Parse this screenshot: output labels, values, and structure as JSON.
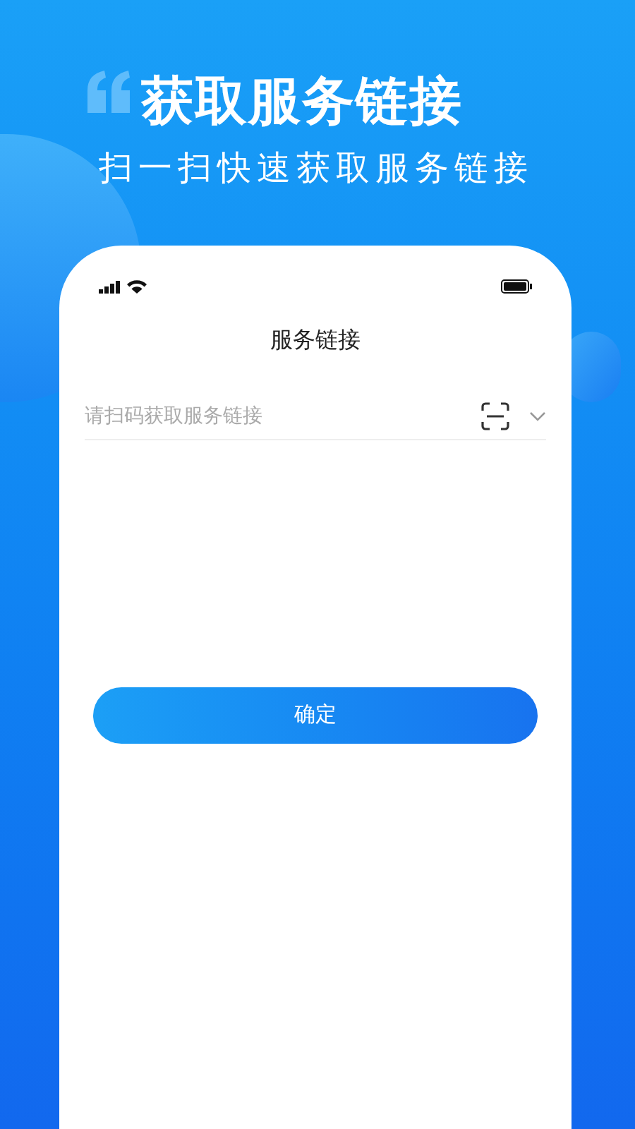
{
  "headline": "获取服务链接",
  "subtitle": "扫一扫快速获取服务链接",
  "phone": {
    "title": "服务链接",
    "link_field": {
      "placeholder": "请扫码获取服务链接"
    },
    "confirm_button": "确定"
  }
}
